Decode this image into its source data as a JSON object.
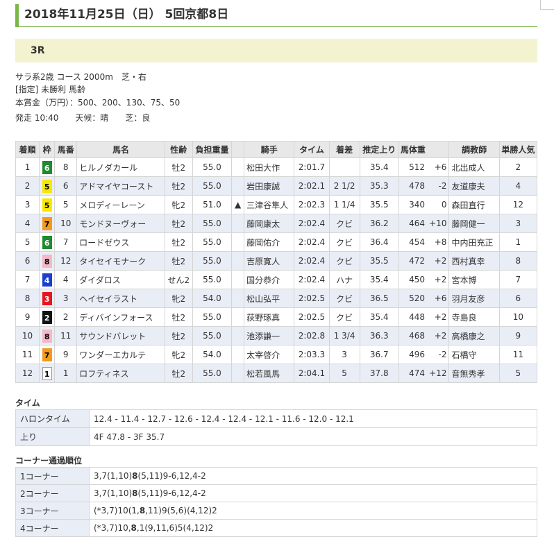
{
  "page_title": "2018年11月25日（日） 5回京都8日",
  "race_number": "3R",
  "info": {
    "line1": "サラ系2歳 コース 2000m　芝・右",
    "line2": "[指定] 未勝利 馬齢",
    "line3": "本賞金（万円）：500、200、130、75、50",
    "line4": "発走 10:40　　天候：晴　　芝：良"
  },
  "headers": [
    "着順",
    "枠",
    "馬番",
    "馬名",
    "性齢",
    "負担重量",
    "",
    "騎手",
    "タイム",
    "着差",
    "推定上り",
    "馬体重",
    "",
    "調教師",
    "単勝人気"
  ],
  "results": [
    {
      "pos": "1",
      "waku": "6",
      "num": "8",
      "name": "ヒルノダカール",
      "sexage": "牡2",
      "weight": "55.0",
      "mark": "",
      "jockey": "松田大作",
      "time": "2:01.7",
      "margin": "",
      "last3f": "35.4",
      "bw": "512",
      "bwdiff": "+6",
      "trainer": "北出成人",
      "pop": "2"
    },
    {
      "pos": "2",
      "waku": "5",
      "num": "6",
      "name": "アドマイヤコースト",
      "sexage": "牡2",
      "weight": "55.0",
      "mark": "",
      "jockey": "岩田康誠",
      "time": "2:02.1",
      "margin": "2 1/2",
      "last3f": "35.3",
      "bw": "478",
      "bwdiff": "-2",
      "trainer": "友道康夫",
      "pop": "4"
    },
    {
      "pos": "3",
      "waku": "5",
      "num": "5",
      "name": "メロディーレーン",
      "sexage": "牝2",
      "weight": "51.0",
      "mark": "▲",
      "jockey": "三津谷隼人",
      "time": "2:02.3",
      "margin": "1 1/4",
      "last3f": "35.5",
      "bw": "340",
      "bwdiff": "0",
      "trainer": "森田直行",
      "pop": "12"
    },
    {
      "pos": "4",
      "waku": "7",
      "num": "10",
      "name": "モンドヌーヴォー",
      "sexage": "牡2",
      "weight": "55.0",
      "mark": "",
      "jockey": "藤岡康太",
      "time": "2:02.4",
      "margin": "クビ",
      "last3f": "36.2",
      "bw": "464",
      "bwdiff": "+10",
      "trainer": "藤岡健一",
      "pop": "3"
    },
    {
      "pos": "5",
      "waku": "6",
      "num": "7",
      "name": "ロードゼウス",
      "sexage": "牡2",
      "weight": "55.0",
      "mark": "",
      "jockey": "藤岡佑介",
      "time": "2:02.4",
      "margin": "クビ",
      "last3f": "36.4",
      "bw": "454",
      "bwdiff": "+8",
      "trainer": "中内田充正",
      "pop": "1"
    },
    {
      "pos": "6",
      "waku": "8",
      "num": "12",
      "name": "タイセイモナーク",
      "sexage": "牡2",
      "weight": "55.0",
      "mark": "",
      "jockey": "吉原寛人",
      "time": "2:02.4",
      "margin": "クビ",
      "last3f": "35.5",
      "bw": "472",
      "bwdiff": "+2",
      "trainer": "西村真幸",
      "pop": "8"
    },
    {
      "pos": "7",
      "waku": "4",
      "num": "4",
      "name": "ダイダロス",
      "sexage": "せん2",
      "weight": "55.0",
      "mark": "",
      "jockey": "国分恭介",
      "time": "2:02.4",
      "margin": "ハナ",
      "last3f": "35.4",
      "bw": "450",
      "bwdiff": "+2",
      "trainer": "宮本博",
      "pop": "7"
    },
    {
      "pos": "8",
      "waku": "3",
      "num": "3",
      "name": "ヘイセイラスト",
      "sexage": "牝2",
      "weight": "54.0",
      "mark": "",
      "jockey": "松山弘平",
      "time": "2:02.5",
      "margin": "クビ",
      "last3f": "36.5",
      "bw": "520",
      "bwdiff": "+6",
      "trainer": "羽月友彦",
      "pop": "6"
    },
    {
      "pos": "9",
      "waku": "2",
      "num": "2",
      "name": "ディバインフォース",
      "sexage": "牡2",
      "weight": "55.0",
      "mark": "",
      "jockey": "荻野琢真",
      "time": "2:02.5",
      "margin": "クビ",
      "last3f": "35.4",
      "bw": "448",
      "bwdiff": "+2",
      "trainer": "寺島良",
      "pop": "10"
    },
    {
      "pos": "10",
      "waku": "8",
      "num": "11",
      "name": "サウンドバレット",
      "sexage": "牡2",
      "weight": "55.0",
      "mark": "",
      "jockey": "池添謙一",
      "time": "2:02.8",
      "margin": "1 3/4",
      "last3f": "36.3",
      "bw": "468",
      "bwdiff": "+2",
      "trainer": "高橋康之",
      "pop": "9"
    },
    {
      "pos": "11",
      "waku": "7",
      "num": "9",
      "name": "ワンダーエカルテ",
      "sexage": "牝2",
      "weight": "54.0",
      "mark": "",
      "jockey": "太宰啓介",
      "time": "2:03.3",
      "margin": "3",
      "last3f": "36.7",
      "bw": "496",
      "bwdiff": "-2",
      "trainer": "石橋守",
      "pop": "11"
    },
    {
      "pos": "12",
      "waku": "1",
      "num": "1",
      "name": "ロフティネス",
      "sexage": "牡2",
      "weight": "55.0",
      "mark": "",
      "jockey": "松若風馬",
      "time": "2:04.1",
      "margin": "5",
      "last3f": "37.8",
      "bw": "474",
      "bwdiff": "+12",
      "trainer": "音無秀孝",
      "pop": "5"
    }
  ],
  "waku_colors": {
    "1": {
      "bg": "#ffffff",
      "fg": "#000000",
      "border": "#999999"
    },
    "2": {
      "bg": "#111111",
      "fg": "#ffffff",
      "border": "#111111"
    },
    "3": {
      "bg": "#e8141e",
      "fg": "#ffffff",
      "border": "#e8141e"
    },
    "4": {
      "bg": "#1a3fd0",
      "fg": "#ffffff",
      "border": "#1a3fd0"
    },
    "5": {
      "bg": "#f6e800",
      "fg": "#000000",
      "border": "#f6e800"
    },
    "6": {
      "bg": "#1f8a2f",
      "fg": "#ffffff",
      "border": "#1f8a2f"
    },
    "7": {
      "bg": "#f29a1e",
      "fg": "#000000",
      "border": "#f29a1e"
    },
    "8": {
      "bg": "#f5b8c8",
      "fg": "#000000",
      "border": "#f5b8c8"
    }
  },
  "time_section": {
    "label": "タイム",
    "rows": [
      {
        "label": "ハロンタイム",
        "value": "12.4 - 11.4 - 12.7 - 12.6 - 12.4 - 12.4 - 12.1 - 11.6 - 12.0 - 12.1"
      },
      {
        "label": "上り",
        "value": "4F 47.8 - 3F 35.7"
      }
    ]
  },
  "corner_section": {
    "label": "コーナー通過順位",
    "rows": [
      {
        "label": "1コーナー",
        "pre": "3,7(1,10)",
        "bold": "8",
        "post": "(5,11)9-6,12,4-2"
      },
      {
        "label": "2コーナー",
        "pre": "3,7(1,10)",
        "bold": "8",
        "post": "(5,11)9-6,12,4-2"
      },
      {
        "label": "3コーナー",
        "pre": "(*3,7)10(1,",
        "bold": "8",
        "post": ",11)9(5,6)(4,12)2"
      },
      {
        "label": "4コーナー",
        "pre": "(*3,7)10,",
        "bold": "8",
        "post": ",1(9,11,6)5(4,12)2"
      }
    ]
  }
}
